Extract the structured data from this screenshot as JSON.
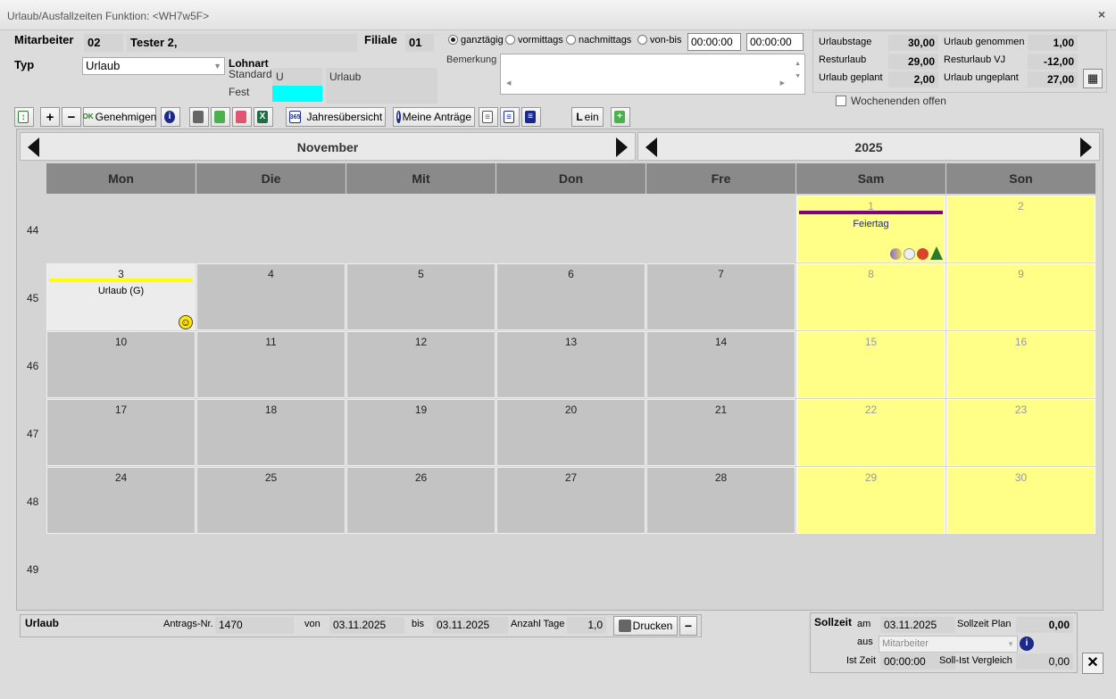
{
  "window": {
    "title": "Urlaub/Ausfallzeiten Funktion: <WH7w5F>",
    "close": "×"
  },
  "employee": {
    "label": "Mitarbeiter",
    "number": "02",
    "name": "Tester 2,",
    "branch_label": "Filiale",
    "branch": "01"
  },
  "type": {
    "label": "Typ",
    "value": "Urlaub"
  },
  "lohnart": {
    "label": "Lohnart",
    "standard_label": "Standard",
    "standard_code": "U",
    "standard_name": "Urlaub",
    "fest_label": "Fest",
    "fest_color": "#00ffff"
  },
  "time_mode": {
    "options": [
      "ganztägig",
      "vormittags",
      "nachmittags",
      "von-bis"
    ],
    "selected": "ganztägig",
    "from": "00:00:00",
    "to": "00:00:00"
  },
  "remark": {
    "label": "Bemerkung",
    "value": ""
  },
  "summary": {
    "urlaubstage_label": "Urlaubstage",
    "urlaubstage": "30,00",
    "resturlaub_label": "Resturlaub",
    "resturlaub": "29,00",
    "geplant_label": "Urlaub geplant",
    "geplant": "2,00",
    "genommen_label": "Urlaub genommen",
    "genommen": "1,00",
    "rest_vj_label": "Resturlaub VJ",
    "rest_vj": "-12,00",
    "ungeplant_label": "Urlaub ungeplant",
    "ungeplant": "27,00",
    "weekends_label": "Wochenenden offen"
  },
  "toolbar": {
    "approve": "Genehmigen",
    "overview": "Jahresübersicht",
    "my_requests": "Meine Anträge",
    "l_ein": "ein",
    "l_letter": "L",
    "plus": "+",
    "minus": "−",
    "ok": "OK",
    "info": "i",
    "xls": "X",
    "yr": "365"
  },
  "calendar": {
    "month": "November",
    "year": "2025",
    "days": [
      "Mon",
      "Die",
      "Mit",
      "Don",
      "Fre",
      "Sam",
      "Son"
    ],
    "weeks": [
      "44",
      "45",
      "46",
      "47",
      "48",
      "49"
    ],
    "holiday_label": "Feiertag",
    "holiday_color": "#800080",
    "vacation_label": "Urlaub (G)",
    "vacation_color": "#ffff00",
    "weekend_color": "#ffff88",
    "smiley": "☺"
  },
  "request": {
    "title": "Urlaub",
    "nr_label": "Antrags-Nr.",
    "nr": "1470",
    "from_label": "von",
    "from": "03.11.2025",
    "to_label": "bis",
    "to": "03.11.2025",
    "days_label": "Anzahl Tage",
    "days": "1,0",
    "print_label": "Drucken",
    "minus": "−"
  },
  "sollzeit": {
    "title": "Sollzeit",
    "am_label": "am",
    "am": "03.11.2025",
    "plan_label": "Sollzeit Plan",
    "plan": "0,00",
    "aus_label": "aus",
    "aus": "Mitarbeiter",
    "ist_label": "Ist Zeit",
    "ist": "00:00:00",
    "diff_label": "Soll-Ist Vergleich",
    "diff": "0,00"
  },
  "close_button": "✕"
}
